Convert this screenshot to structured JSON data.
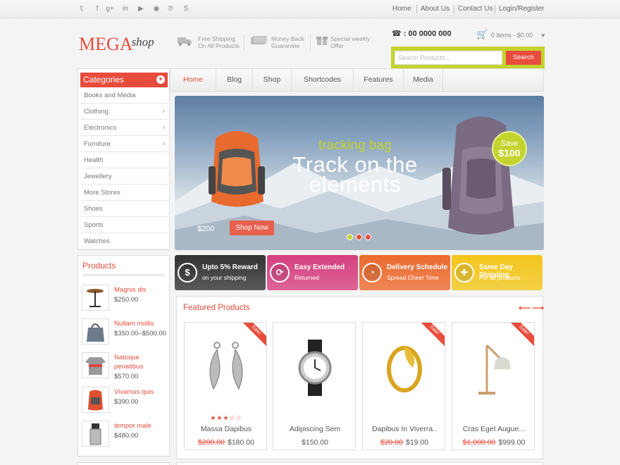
{
  "topbar": {
    "social_icons": [
      "twitter-icon",
      "facebook-icon",
      "google-plus-icon",
      "linkedin-icon",
      "youtube-icon",
      "rss-icon",
      "pinterest-icon",
      "skype-icon"
    ],
    "social_glyphs": [
      "𝕥",
      "f",
      "g+",
      "in",
      "▶",
      "◉",
      "℗",
      "S"
    ],
    "links": [
      "Home",
      "About Us",
      "Contact Us",
      "Login/Register"
    ]
  },
  "header": {
    "logo_main": "MEGA",
    "logo_sub": "shop",
    "features": [
      {
        "icon": "truck-icon",
        "line1": "Free Shipping",
        "line2": "On All Products"
      },
      {
        "icon": "money-icon",
        "line1": "Money Back",
        "line2": "Guarantee"
      },
      {
        "icon": "gift-icon",
        "line1": "Special weekly",
        "line2": "Offer"
      }
    ],
    "phone": ": 00 0000 000",
    "cart": "0 items - $0.00",
    "search_placeholder": "Search Products...",
    "search_button": "Search"
  },
  "categories": {
    "title": "Categories",
    "items": [
      {
        "label": "Books and Media",
        "arrow": false
      },
      {
        "label": "Clothing",
        "arrow": true
      },
      {
        "label": "Electronics",
        "arrow": true
      },
      {
        "label": "Furniture",
        "arrow": true
      },
      {
        "label": "Health",
        "arrow": false
      },
      {
        "label": "Jewellery",
        "arrow": false
      },
      {
        "label": "More Stores",
        "arrow": false
      },
      {
        "label": "Shoes",
        "arrow": false
      },
      {
        "label": "Sports",
        "arrow": false
      },
      {
        "label": "Watches",
        "arrow": false
      }
    ]
  },
  "nav": {
    "items": [
      "Home",
      "Blog",
      "Shop",
      "Shortcodes",
      "Features",
      "Media"
    ],
    "active": "Home"
  },
  "hero": {
    "subtitle": "tracking bag",
    "title_line1": "Track on the",
    "title_line2": "elements",
    "save_label": "Save",
    "save_amount": "$100",
    "price": "$200",
    "button": "Shop Now",
    "dots": 3,
    "active_dot": 1
  },
  "promos": [
    {
      "title": "Upto 5% Reward",
      "subtitle": "on your shipping",
      "icon": "dollar-icon",
      "glyph": "$",
      "color": "#333333"
    },
    {
      "title": "Easy Extended",
      "subtitle": "Returned",
      "icon": "refresh-icon",
      "glyph": "⟳",
      "color": "#d6407f"
    },
    {
      "title": "Delivery Schedule",
      "subtitle": "Spread Cheer Time",
      "icon": "clock-icon",
      "glyph": "◔",
      "color": "#ec6a2e"
    },
    {
      "title": "Same Day Shipping",
      "subtitle": "For all products",
      "icon": "gift-icon",
      "glyph": "✚",
      "color": "#f3c61b"
    }
  ],
  "featured": {
    "title": "Featured Products",
    "products": [
      {
        "name": "Massa Dapibus",
        "old_price": "$200.00",
        "price": "$180.00",
        "sale": true,
        "rating": 3
      },
      {
        "name": "Adipiscing Sem",
        "old_price": "",
        "price": "$150.00",
        "sale": false,
        "rating": 0
      },
      {
        "name": "Dapibus In Viverra..",
        "old_price": "$20.00",
        "price": "$19.00",
        "sale": true,
        "rating": 0
      },
      {
        "name": "Cras Eget Augue...",
        "old_price": "$1,000.00",
        "price": "$999.00",
        "sale": true,
        "rating": 0
      }
    ],
    "sale_label": "Sale!"
  },
  "products_sidebar": {
    "title": "Products",
    "items": [
      {
        "name": "Magnis dis",
        "price": "$250.00",
        "icon": "table-icon"
      },
      {
        "name": "Nullam mollis",
        "price": "$350.00–$500.00",
        "icon": "bag-icon"
      },
      {
        "name": "Natoque penatibus",
        "price": "$570.00",
        "icon": "tshirt-icon"
      },
      {
        "name": "Vivamus quis",
        "price": "$390.00",
        "icon": "backpack-icon"
      },
      {
        "name": "tempor male",
        "price": "$480.00",
        "icon": "bottle-icon"
      }
    ]
  },
  "colors": {
    "accent": "#e74c3c",
    "lime": "#c4d42e"
  }
}
